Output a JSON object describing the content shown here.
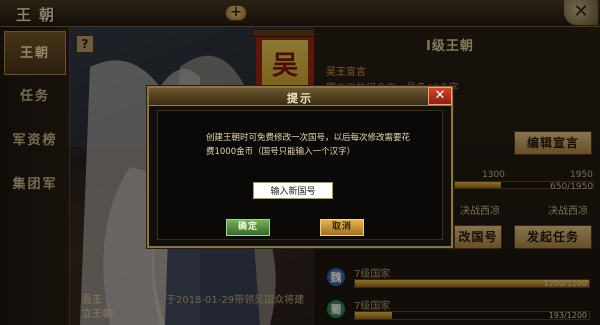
{
  "header": {
    "title": "王朝",
    "add_symbol": "+",
    "close_symbol": "✕"
  },
  "sidebar": {
    "items": [
      {
        "label": "王朝",
        "active": true
      },
      {
        "label": "任务",
        "active": false
      },
      {
        "label": "军资榜",
        "active": false
      },
      {
        "label": "集团军",
        "active": false
      }
    ]
  },
  "art": {
    "help_symbol": "?",
    "banner_char": "吴",
    "caption_line1": "吾王",
    "caption_line2": "立王朝!",
    "record": "于2018-01-29带领吴国众将建"
  },
  "right_panel": {
    "title": "Ⅰ级王朝",
    "sub_label": "吴王宣言",
    "desc": "国二二的组合言，最多40个字",
    "edit_button": "编辑宣言",
    "progress": {
      "left_value": "1300",
      "right_value": "1950",
      "current": "650/1950",
      "fraction": 0.333
    },
    "war_left": "决战西凉",
    "war_right": "决战西凉",
    "nation_button": "改国号",
    "war_button": "发起任务",
    "nations": [
      {
        "badge": "魏",
        "name": "7级国家",
        "value": "1200/1200",
        "fraction": 1.0,
        "color": "#3a5a9a"
      },
      {
        "badge": "蜀",
        "name": "7级国家",
        "value": "193/1200",
        "fraction": 0.16,
        "color": "#3a7a48"
      }
    ]
  },
  "modal": {
    "title": "提示",
    "close_symbol": "✕",
    "message": "创建王朝时可免费修改一次国号，以后每次修改需要花费1000金币（国号只能输入一个汉字）",
    "input_value": "输入新国号",
    "confirm_label": "确定",
    "cancel_label": "取消"
  }
}
